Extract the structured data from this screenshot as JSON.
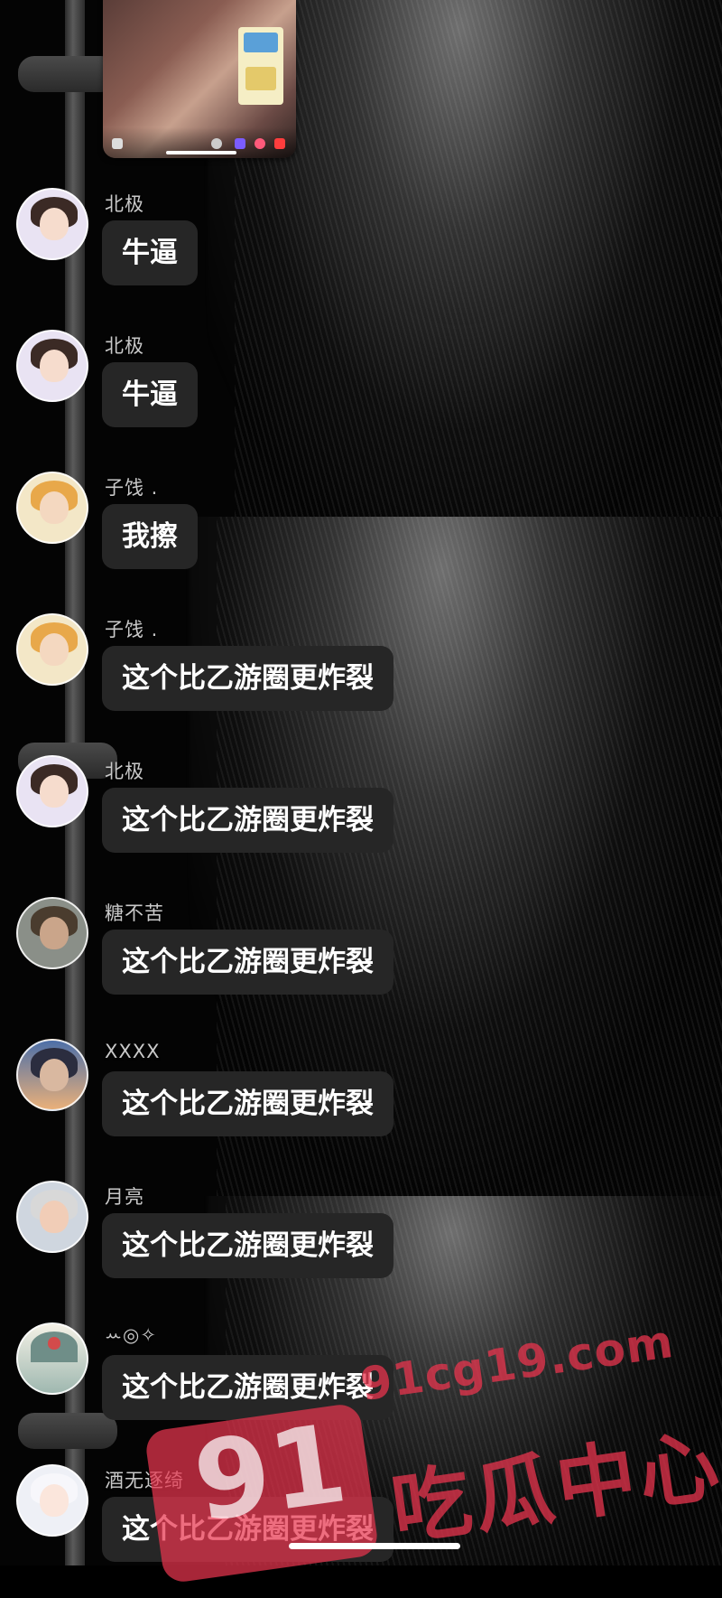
{
  "messages": [
    {
      "nickname": "北极",
      "text": "牛逼",
      "avatar": "avatar-girl-glasses"
    },
    {
      "nickname": "北极",
      "text": "牛逼",
      "avatar": "avatar-girl-glasses"
    },
    {
      "nickname": "子饯 .",
      "text": "我擦",
      "avatar": "avatar-tiger-hood"
    },
    {
      "nickname": "子饯 .",
      "text": "这个比乙游圈更炸裂",
      "avatar": "avatar-tiger-hood"
    },
    {
      "nickname": "北极",
      "text": "这个比乙游圈更炸裂",
      "avatar": "avatar-girl-glasses"
    },
    {
      "nickname": "糖不苦",
      "text": "这个比乙游圈更炸裂",
      "avatar": "avatar-man-photo"
    },
    {
      "nickname": "XXXX",
      "text": "这个比乙游圈更炸裂",
      "avatar": "avatar-anime-sky"
    },
    {
      "nickname": "月亮",
      "text": "这个比乙游圈更炸裂",
      "avatar": "avatar-glasses-boy"
    },
    {
      "nickname": "ꕀ◎✧",
      "text": "这个比乙游圈更炸裂",
      "avatar": "avatar-landscape"
    },
    {
      "nickname": "酒无逐绮",
      "text": "这个比乙游圈更炸裂",
      "avatar": "avatar-white-hair"
    }
  ],
  "watermark": {
    "badge": "91",
    "url": "91cg19.com",
    "name": "吃瓜中心"
  },
  "colors": {
    "bubble": "#262626",
    "nickname": "#c9c9c9",
    "watermark": "#e8344e"
  }
}
